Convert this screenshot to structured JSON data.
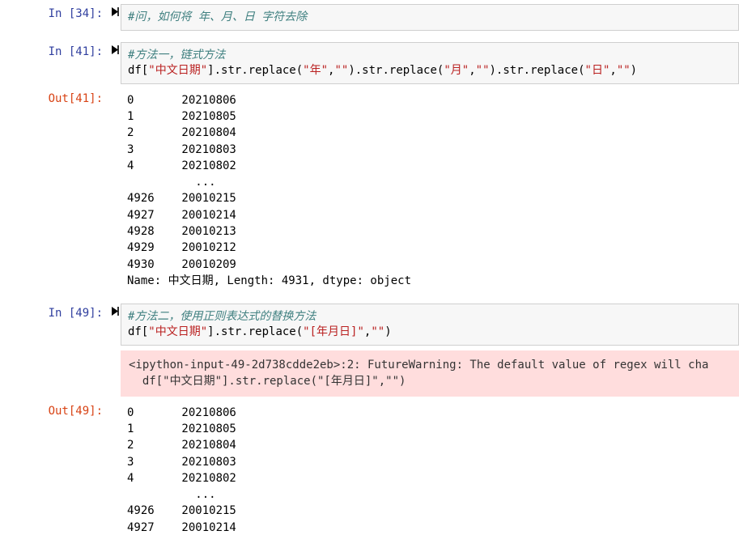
{
  "cells": {
    "c34": {
      "prompt": "In  [34]:",
      "comment": "#问，如何将 年、月、日 字符去除"
    },
    "c41": {
      "prompt": "In  [41]:",
      "comment": "#方法一，链式方法",
      "code_pre1": "df[",
      "code_s1": "\"中文日期\"",
      "code_mid1": "].str.replace(",
      "code_s2": "\"年\"",
      "code_mid2": ",",
      "code_s3": "\"\"",
      "code_mid3": ").str.replace(",
      "code_s4": "\"月\"",
      "code_mid4": ",",
      "code_s5": "\"\"",
      "code_mid5": ").str.replace(",
      "code_s6": "\"日\"",
      "code_mid6": ",",
      "code_s7": "\"\"",
      "code_mid7": ")"
    },
    "out41": {
      "prompt": "Out[41]:",
      "text": "0       20210806\n1       20210805\n2       20210804\n3       20210803\n4       20210802\n          ...   \n4926    20010215\n4927    20010214\n4928    20010213\n4929    20010212\n4930    20010209\nName: 中文日期, Length: 4931, dtype: object"
    },
    "c49": {
      "prompt": "In  [49]:",
      "comment": "#方法二，使用正则表达式的替换方法",
      "code_pre1": "df[",
      "code_s1": "\"中文日期\"",
      "code_mid1": "].str.replace(",
      "code_s2": "\"[年月日]\"",
      "code_mid2": ",",
      "code_s3": "\"\"",
      "code_mid3": ")"
    },
    "warn49": {
      "text": "<ipython-input-49-2d738cdde2eb>:2: FutureWarning: The default value of regex will cha\n  df[\"中文日期\"].str.replace(\"[年月日]\",\"\")"
    },
    "out49": {
      "prompt": "Out[49]:",
      "text": "0       20210806\n1       20210805\n2       20210804\n3       20210803\n4       20210802\n          ...   \n4926    20010215\n4927    20010214"
    }
  }
}
